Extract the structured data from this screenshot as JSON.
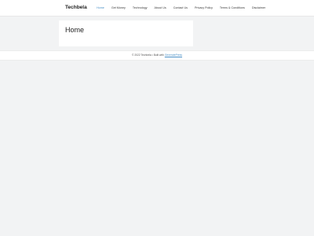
{
  "header": {
    "site_title": "Techbela",
    "nav": [
      {
        "label": "Home",
        "active": true
      },
      {
        "label": "Get Money",
        "active": false
      },
      {
        "label": "Technology",
        "active": false
      },
      {
        "label": "About Us",
        "active": false
      },
      {
        "label": "Contact Us",
        "active": false
      },
      {
        "label": "Privacy Policy",
        "active": false
      },
      {
        "label": "Terms & Conditions",
        "active": false
      },
      {
        "label": "Disclaimer",
        "active": false
      }
    ]
  },
  "main": {
    "page_title": "Home"
  },
  "footer": {
    "copyright": "© 2022 Techbela • Built with",
    "link_label": "GeneratePress"
  },
  "colors": {
    "background": "#f2f3f4",
    "surface": "#ffffff",
    "accent": "#4a90c7",
    "text": "#222222"
  }
}
